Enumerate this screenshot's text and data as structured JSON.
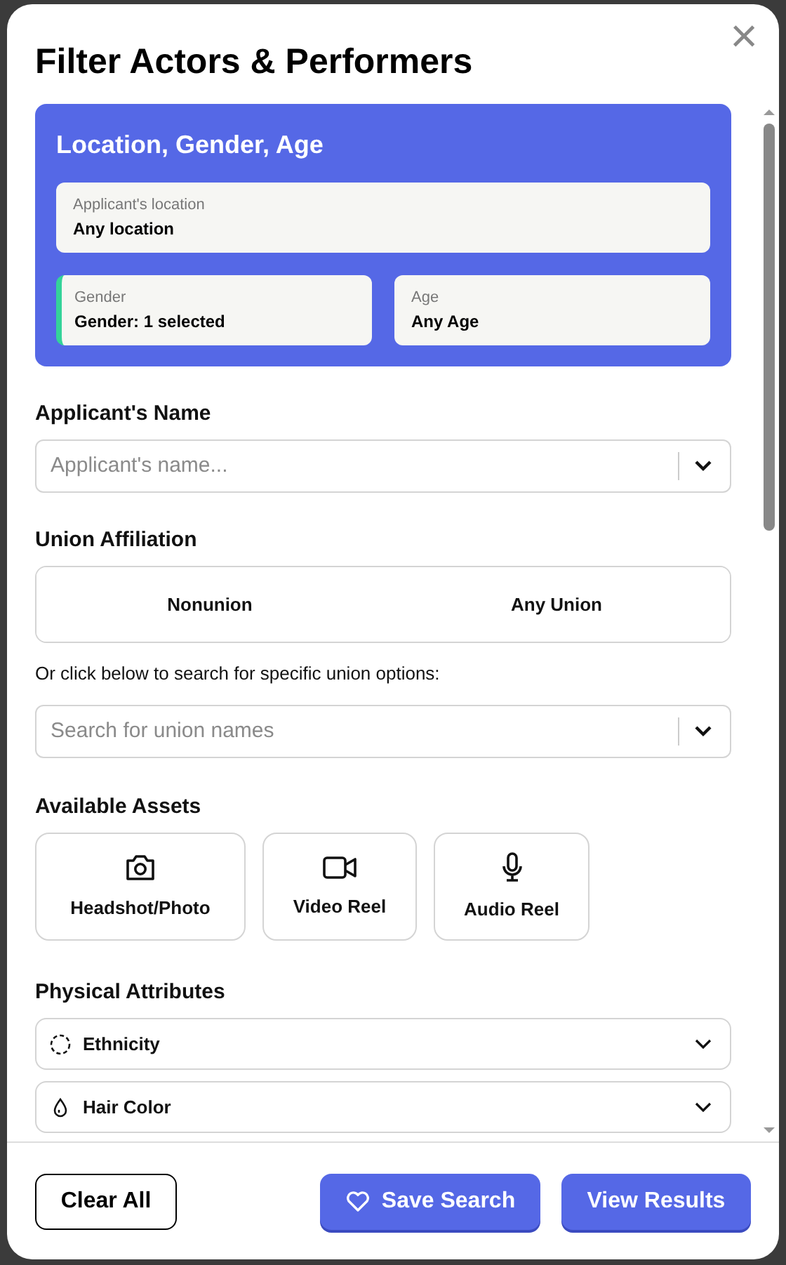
{
  "dialog": {
    "title": "Filter Actors & Performers",
    "close_label": "×"
  },
  "location_card": {
    "title": "Location, Gender, Age",
    "fields": [
      {
        "label": "Applicant's location",
        "value": "Any location",
        "highlighted": false,
        "wide": true
      },
      {
        "label": "Gender",
        "value": "Gender: 1 selected",
        "highlighted": true,
        "wide": false
      },
      {
        "label": "Age",
        "value": "Any Age",
        "highlighted": false,
        "wide": false
      }
    ]
  },
  "name_section": {
    "heading": "Applicant's Name",
    "placeholder": "Applicant's name..."
  },
  "union_section": {
    "heading": "Union Affiliation",
    "options": [
      {
        "label": "Nonunion",
        "selected": false
      },
      {
        "label": "Any Union",
        "selected": false
      }
    ],
    "hint": "Or click below to search for specific union options:",
    "placeholder": "Search for union names"
  },
  "assets_section": {
    "heading": "Available Assets",
    "items": [
      {
        "kind": "camera",
        "label": "Headshot/Photo",
        "selected": false
      },
      {
        "kind": "video",
        "label": "Video Reel",
        "selected": false
      },
      {
        "kind": "mic",
        "label": "Audio Reel",
        "selected": false
      }
    ]
  },
  "physical_section": {
    "heading": "Physical Attributes",
    "dropdowns": [
      {
        "kind": "ethnicity",
        "label": "Ethnicity"
      },
      {
        "kind": "hair",
        "label": "Hair Color"
      }
    ]
  },
  "footer": {
    "buttons": [
      {
        "kind": "outline",
        "label": "Clear All"
      },
      {
        "kind": "save",
        "label": "Save Search"
      },
      {
        "kind": "primary",
        "label": "View Results"
      }
    ]
  }
}
